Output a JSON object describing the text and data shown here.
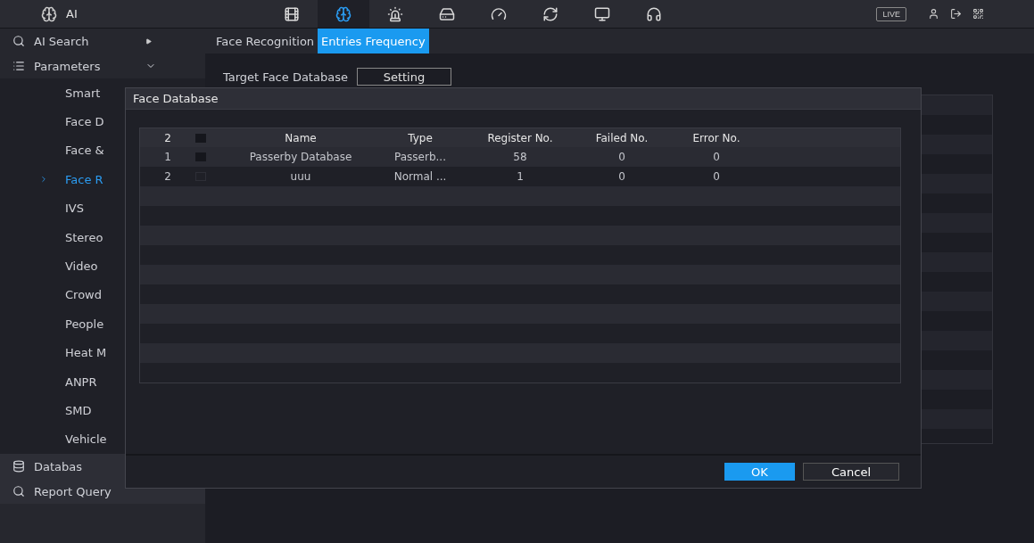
{
  "topbar": {
    "title": "AI",
    "nav": [
      {
        "kind": "reel",
        "selected": false
      },
      {
        "kind": "brain",
        "selected": true
      },
      {
        "kind": "alarm",
        "selected": false
      },
      {
        "kind": "storage",
        "selected": false
      },
      {
        "kind": "gauge",
        "selected": false
      },
      {
        "kind": "sync",
        "selected": false
      },
      {
        "kind": "monitor",
        "selected": false
      },
      {
        "kind": "headphones",
        "selected": false
      }
    ],
    "live": "LIVE"
  },
  "sidebar": {
    "items": [
      {
        "label": "AI Search",
        "kind": "search",
        "expanded": false
      },
      {
        "label": "Parameters",
        "kind": "list",
        "expanded": true,
        "children": [
          {
            "label": "Smart",
            "selected": false
          },
          {
            "label": "Face D",
            "selected": false
          },
          {
            "label": "Face &",
            "selected": false
          },
          {
            "label": "Face R",
            "selected": true
          },
          {
            "label": "IVS",
            "selected": false
          },
          {
            "label": "Stereo",
            "selected": false
          },
          {
            "label": "Video",
            "selected": false
          },
          {
            "label": "Crowd",
            "selected": false
          },
          {
            "label": "People",
            "selected": false
          },
          {
            "label": "Heat M",
            "selected": false
          },
          {
            "label": "ANPR",
            "selected": false
          },
          {
            "label": "SMD",
            "selected": false
          },
          {
            "label": "Vehicle",
            "selected": false
          }
        ]
      },
      {
        "label": "Databas",
        "kind": "database"
      },
      {
        "label": "Report Query",
        "kind": "search"
      }
    ]
  },
  "tabs": [
    {
      "label": "Face Recognition",
      "selected": false
    },
    {
      "label": "Entries Frequency",
      "selected": true
    }
  ],
  "target": {
    "label": "Target Face Database",
    "button": "Setting"
  },
  "dialog": {
    "title": "Face Database",
    "columns": [
      "2",
      "Name",
      "Type",
      "Register No.",
      "Failed No.",
      "Error No."
    ],
    "header_checked": true,
    "rows": [
      {
        "index": "1",
        "checked": true,
        "name": "Passerby Database",
        "type": "Passerb...",
        "register": "58",
        "failed": "0",
        "error": "0"
      },
      {
        "index": "2",
        "checked": false,
        "name": "uuu",
        "type": "Normal ...",
        "register": "1",
        "failed": "0",
        "error": "0"
      }
    ],
    "buttons": [
      {
        "label": "OK",
        "kind": "primary"
      },
      {
        "label": "Cancel",
        "kind": "secondary"
      }
    ]
  }
}
